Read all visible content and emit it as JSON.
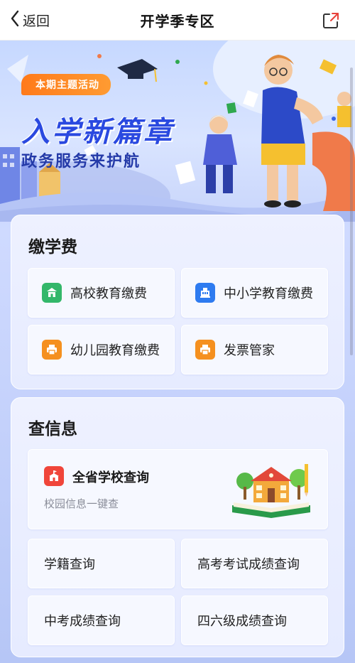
{
  "header": {
    "back_label": "返回",
    "title": "开学季专区"
  },
  "banner": {
    "badge": "本期主题活动",
    "headline": "入学新篇章",
    "subline": "政务服务来护航"
  },
  "fees": {
    "title": "缴学费",
    "items": [
      {
        "label": "高校教育缴费",
        "icon": "university-icon",
        "color": "#33b76a"
      },
      {
        "label": "中小学教育缴费",
        "icon": "school-building-icon",
        "color": "#2e7bf0"
      },
      {
        "label": "幼儿园教育缴费",
        "icon": "printer-icon",
        "color": "#f5901f"
      },
      {
        "label": "发票管家",
        "icon": "printer-icon",
        "color": "#f5901f"
      }
    ]
  },
  "info": {
    "title": "查信息",
    "feature": {
      "title": "全省学校查询",
      "subtitle": "校园信息一键查",
      "icon": "school-icon",
      "color": "#f0453a"
    },
    "items": [
      {
        "label": "学籍查询"
      },
      {
        "label": "高考考试成绩查询"
      },
      {
        "label": "中考成绩查询"
      },
      {
        "label": "四六级成绩查询"
      }
    ]
  }
}
